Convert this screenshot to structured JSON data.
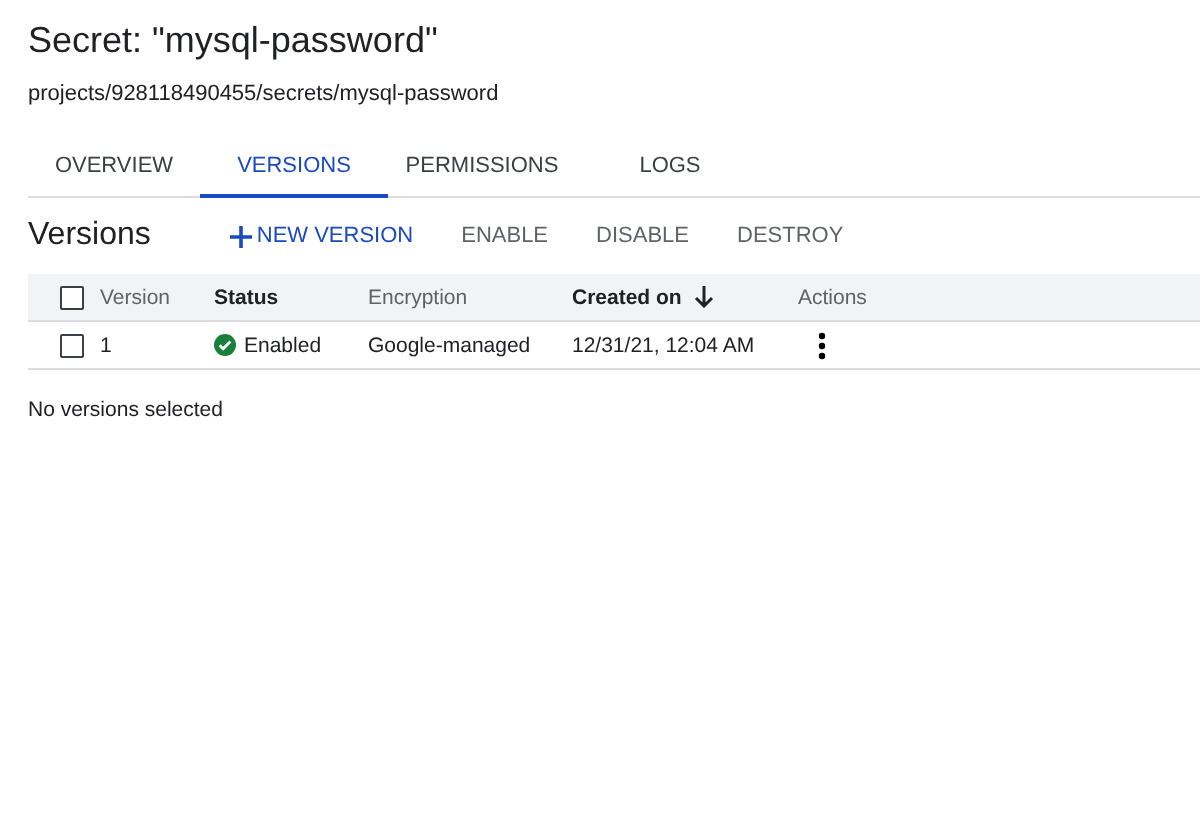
{
  "title": "Secret: \"mysql-password\"",
  "path": "projects/928118490455/secrets/mysql-password",
  "tabs": [
    {
      "label": "OVERVIEW",
      "selected": false
    },
    {
      "label": "VERSIONS",
      "selected": true
    },
    {
      "label": "PERMISSIONS",
      "selected": false
    },
    {
      "label": "LOGS",
      "selected": false
    }
  ],
  "section_title": "Versions",
  "actions": [
    {
      "label": "NEW VERSION",
      "kind": "add",
      "disabled": false
    },
    {
      "label": "ENABLE",
      "kind": "plain",
      "disabled": true
    },
    {
      "label": "DISABLE",
      "kind": "plain",
      "disabled": true
    },
    {
      "label": "DESTROY",
      "kind": "plain",
      "disabled": true
    }
  ],
  "table": {
    "header_checked": false,
    "columns": [
      {
        "label": "Version",
        "bold": false
      },
      {
        "label": "Status",
        "bold": true
      },
      {
        "label": "Encryption",
        "bold": false
      },
      {
        "label": "Created on",
        "bold": true,
        "sorted": true
      },
      {
        "label": "Actions",
        "bold": false
      }
    ],
    "rows": [
      {
        "checked": false,
        "version": "1",
        "status": "Enabled",
        "status_ok": true,
        "encryption": "Google-managed",
        "created": "12/31/21, 12:04 AM"
      }
    ]
  },
  "footer": "No versions selected"
}
